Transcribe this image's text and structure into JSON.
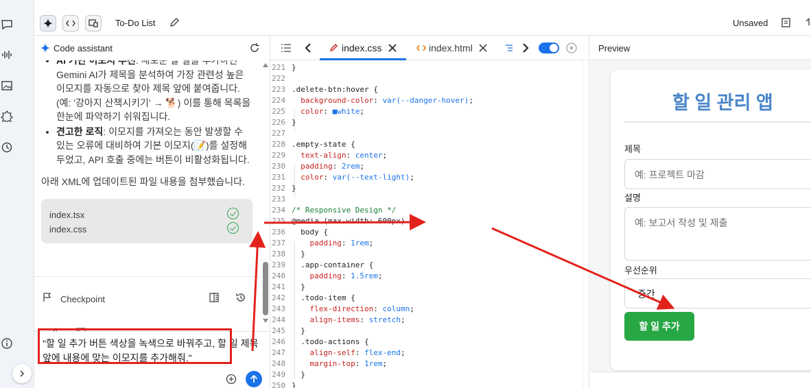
{
  "topbar": {
    "title": "To-Do List",
    "status": "Unsaved"
  },
  "assistant": {
    "header_title": "Code assistant",
    "bullets": [
      {
        "bold": "AI 기반 이모지 추천",
        "text": ": 새로운 할 일을 추가하면 Gemini AI가 제목을 분석하여 가장 관련성 높은 이모지를 자동으로 찾아 제목 앞에 붙여줍니다. (예: '강아지 산책시키기' → 🐕) 이를 통해 목록을 한눈에 파악하기 쉬워집니다."
      },
      {
        "bold": "견고한 로직",
        "text": ": 이모지를 가져오는 동안 발생할 수 있는 오류에 대비하여 기본 이모지(📝)를 설정해 두었고, API 호출 중에는 버튼이 비활성화됩니다."
      }
    ],
    "paragraph": "아래 XML에 업데이트된 파일 내용을 첨부했습니다.",
    "files": [
      "index.tsx",
      "index.css"
    ],
    "checkpoint_label": "Checkpoint",
    "prompt": "\"할 일 추가 버튼 색상을 녹색으로 바꿔주고, 할 일 제목 앞에 내용에 맞는 이모지를 추가해줘.\""
  },
  "editor": {
    "tabs": [
      {
        "label": "index.css",
        "active": true
      },
      {
        "label": "index.html",
        "active": false
      }
    ],
    "lines": [
      {
        "n": "221",
        "html": "}"
      },
      {
        "n": "222",
        "html": ""
      },
      {
        "n": "223",
        "html": ".delete-btn:hover {"
      },
      {
        "n": "224",
        "html": "  background-color: var(--danger-hover);"
      },
      {
        "n": "225",
        "html": "  color: ■white;"
      },
      {
        "n": "226",
        "html": "}"
      },
      {
        "n": "227",
        "html": ""
      },
      {
        "n": "228",
        "html": ".empty-state {"
      },
      {
        "n": "229",
        "html": "  text-align: center;"
      },
      {
        "n": "230",
        "html": "  padding: 2rem;"
      },
      {
        "n": "231",
        "html": "  color: var(--text-light);"
      },
      {
        "n": "232",
        "html": "}"
      },
      {
        "n": "233",
        "html": ""
      },
      {
        "n": "234",
        "html": "/* Responsive Design */"
      },
      {
        "n": "235",
        "html": "@media (max-width: 600px) {"
      },
      {
        "n": "236",
        "html": "  body {"
      },
      {
        "n": "237",
        "html": "    padding: 1rem;"
      },
      {
        "n": "238",
        "html": "  }"
      },
      {
        "n": "239",
        "html": "  .app-container {"
      },
      {
        "n": "240",
        "html": "    padding: 1.5rem;"
      },
      {
        "n": "241",
        "html": "  }"
      },
      {
        "n": "242",
        "html": "  .todo-item {"
      },
      {
        "n": "243",
        "html": "    flex-direction: column;"
      },
      {
        "n": "244",
        "html": "    align-items: stretch;"
      },
      {
        "n": "245",
        "html": "  }"
      },
      {
        "n": "246",
        "html": "  .todo-actions {"
      },
      {
        "n": "247",
        "html": "    align-self: flex-end;"
      },
      {
        "n": "248",
        "html": "    margin-top: 1rem;"
      },
      {
        "n": "249",
        "html": "  }"
      },
      {
        "n": "250",
        "html": "}"
      }
    ]
  },
  "preview": {
    "header_title": "Preview",
    "app_title": "할 일 관리 앱",
    "title_label": "제목",
    "title_placeholder": "예: 프로젝트 마감",
    "desc_label": "설명",
    "desc_placeholder": "예: 보고서 작성 및 제출",
    "priority_label": "우선순위",
    "priority_value": "중간",
    "add_button": "할 일 추가"
  },
  "colors": {
    "accent_blue": "#1a73e8",
    "add_button_green": "#28a745",
    "annotation_red": "#e3211b",
    "preview_title_blue": "#4a86c8"
  }
}
